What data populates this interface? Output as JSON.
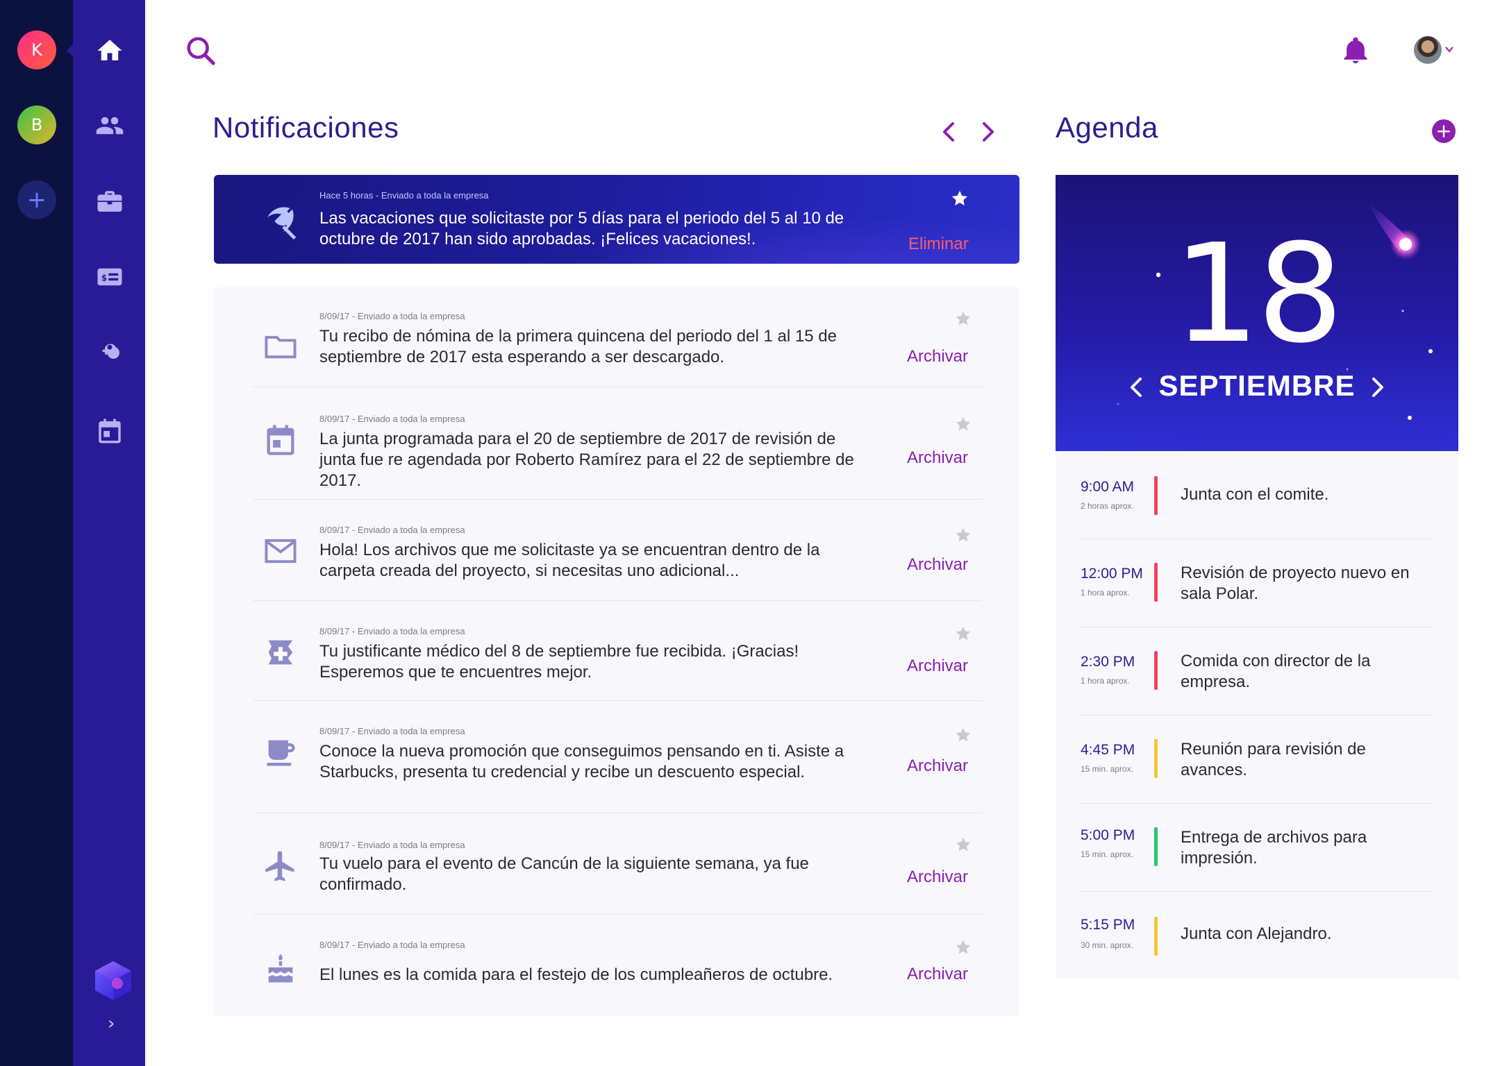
{
  "workspaces": [
    {
      "letter": "K"
    },
    {
      "letter": "B"
    },
    {
      "letter": "+"
    }
  ],
  "nav": {
    "items": [
      "home-icon",
      "people-icon",
      "briefcase-icon",
      "payslip-icon",
      "key-icon",
      "calendar-icon"
    ],
    "expand_label": "›"
  },
  "notifications": {
    "title": "Notificaciones",
    "featured": {
      "meta": "Hace 5 horas - Enviado a toda la empresa",
      "text": "Las vacaciones que solicitaste por 5 días para el periodo del 5 al 10 de octubre de 2017 han sido aprobadas. ¡Felices vacaciones!.",
      "action": "Eliminar",
      "icon": "beach-umbrella-icon"
    },
    "items": [
      {
        "meta": "8/09/17 - Enviado a toda la empresa",
        "text": "Tu recibo de nómina de la primera quincena del periodo del 1 al 15 de septiembre de 2017 esta esperando a ser descargado.",
        "action": "Archivar",
        "icon": "folder-icon"
      },
      {
        "meta": "8/09/17 - Enviado a toda la empresa",
        "text": "La junta programada para el 20 de septiembre de 2017 de revisión de junta fue re agendada por Roberto Ramírez para el 22 de septiembre de 2017.",
        "action": "Archivar",
        "icon": "calendar-icon"
      },
      {
        "meta": "8/09/17 - Enviado a toda la empresa",
        "text": "Hola! Los archivos que me solicitaste ya se encuentran dentro de la carpeta creada del proyecto, si necesitas uno adicional...",
        "action": "Archivar",
        "icon": "mail-icon"
      },
      {
        "meta": "8/09/17 - Enviado a toda la empresa",
        "text": "Tu justificante médico del 8 de septiembre fue recibida. ¡Gracias! Esperemos que te encuentres mejor.",
        "action": "Archivar",
        "icon": "medical-icon"
      },
      {
        "meta": "8/09/17 - Enviado a toda la empresa",
        "text": "Conoce la nueva promoción que conseguimos pensando en ti. Asiste a Starbucks, presenta tu credencial y recibe un descuento especial.",
        "action": "Archivar",
        "icon": "coffee-icon"
      },
      {
        "meta": "8/09/17 - Enviado a toda la empresa",
        "text": "Tu vuelo para el evento de Cancún de la siguiente semana, ya fue confirmado.",
        "action": "Archivar",
        "icon": "airplane-icon"
      },
      {
        "meta": "8/09/17 - Enviado a toda la empresa",
        "text": "El lunes es la comida para el festejo de los cumpleañeros de octubre.",
        "action": "Archivar",
        "icon": "cake-icon"
      }
    ]
  },
  "agenda": {
    "title": "Agenda",
    "day": "18",
    "month": "SEPTIEMBRE",
    "events": [
      {
        "time": "9:00 AM",
        "duration": "2 horas aprox.",
        "title": "Junta con el comite.",
        "color": "#f0435a"
      },
      {
        "time": "12:00 PM",
        "duration": "1 hora aprox.",
        "title": "Revisión de proyecto nuevo en sala Polar.",
        "color": "#f0435a"
      },
      {
        "time": "2:30 PM",
        "duration": "1 hora aprox.",
        "title": "Comida con director de la empresa.",
        "color": "#f0435a"
      },
      {
        "time": "4:45 PM",
        "duration": "15 min. aprox.",
        "title": "Reunión para revisión de avances.",
        "color": "#f5c23a"
      },
      {
        "time": "5:00 PM",
        "duration": "15 min. aprox.",
        "title": "Entrega de archivos para impresión.",
        "color": "#2bc46e"
      },
      {
        "time": "5:15 PM",
        "duration": "30 min. aprox.",
        "title": "Junta con Alejandro.",
        "color": "#f5c23a"
      }
    ]
  },
  "colors": {
    "rail": "#0b1240",
    "nav": "#281b95",
    "accent": "#8a1fb0",
    "title": "#2a1f8f",
    "danger": "#ff5b6b"
  }
}
